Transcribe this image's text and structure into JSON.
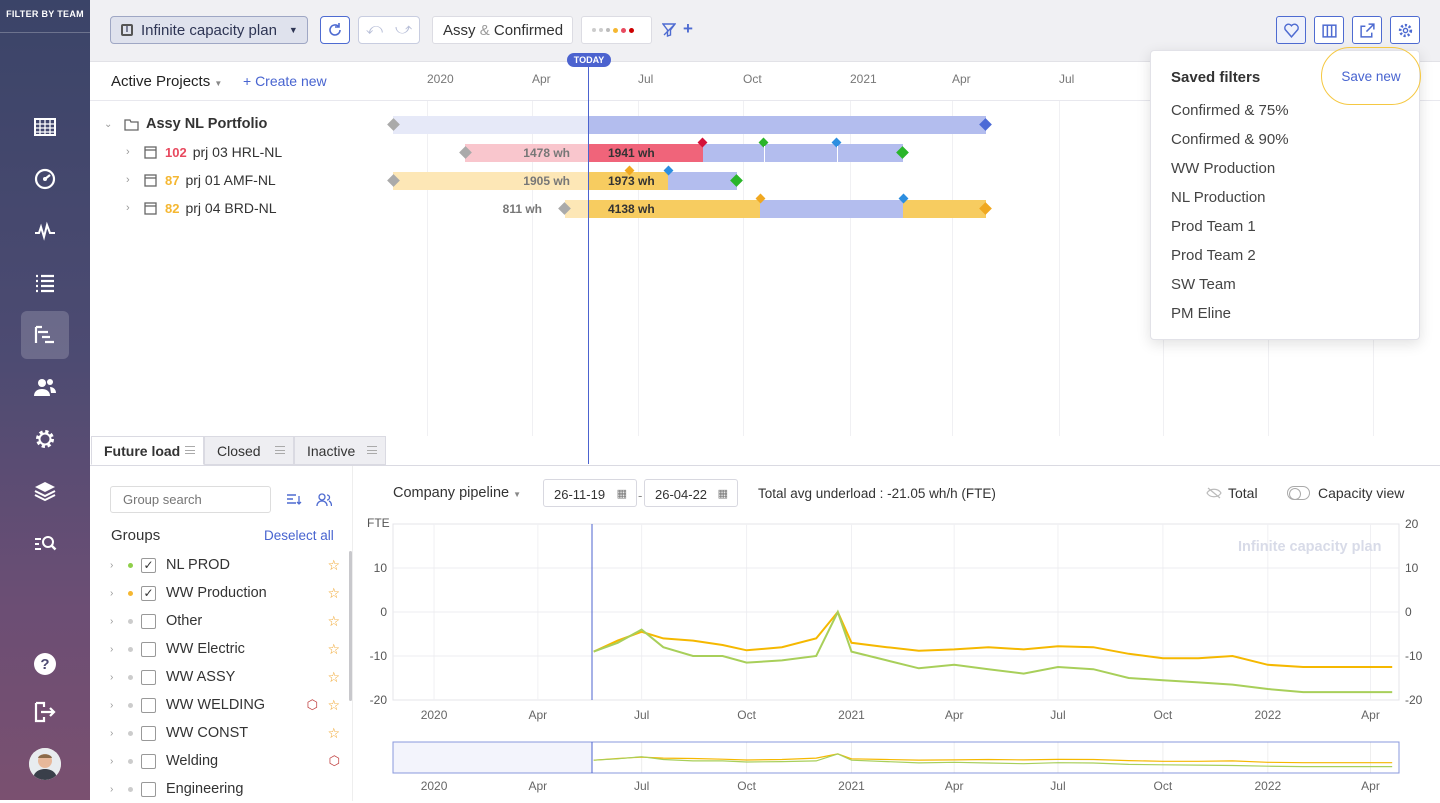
{
  "sidebar": {
    "title": "FILTER BY TEAM"
  },
  "toolbar": {
    "plan_name": "Infinite capacity plan",
    "filter_label_1": "Assy",
    "filter_amp": "&",
    "filter_label_2": "Confirmed",
    "plus": "+"
  },
  "timeline": {
    "active_projects": "Active Projects",
    "create_new": "+  Create new",
    "today": "TODAY",
    "months": [
      "2020",
      "Apr",
      "Jul",
      "Oct",
      "2021",
      "Apr",
      "Jul"
    ]
  },
  "projects": [
    {
      "name": "Assy NL Portfolio"
    },
    {
      "num": "102",
      "name": "prj 03 HRL-NL",
      "past": "1478 wh",
      "future": "1941 wh",
      "num_color": "#e84a5f"
    },
    {
      "num": "87",
      "name": "prj 01 AMF-NL",
      "past": "1905 wh",
      "future": "1973 wh",
      "num_color": "#f5b731"
    },
    {
      "num": "82",
      "name": "prj 04 BRD-NL",
      "past": "811 wh",
      "future": "4138 wh",
      "num_color": "#f5b731"
    }
  ],
  "saved_filters": {
    "title": "Saved filters",
    "save_new": "Save new",
    "items": [
      "Confirmed & 75%",
      "Confirmed & 90%",
      "WW Production",
      "NL Production",
      "Prod Team 1",
      "Prod Team 2",
      "SW Team",
      "PM Eline"
    ]
  },
  "tabs": [
    "Future load",
    "Closed",
    "Inactive"
  ],
  "groups_panel": {
    "search_placeholder": "Group search",
    "title": "Groups",
    "deselect": "Deselect all",
    "items": [
      {
        "name": "NL PROD",
        "checked": true,
        "dot": "#8fcf4a"
      },
      {
        "name": "WW Production",
        "checked": true,
        "dot": "#f5b731"
      },
      {
        "name": "Other",
        "checked": false
      },
      {
        "name": "WW Electric",
        "checked": false
      },
      {
        "name": "WW ASSY",
        "checked": false
      },
      {
        "name": "WW WELDING",
        "checked": false
      },
      {
        "name": "WW CONST",
        "checked": false
      },
      {
        "name": "Welding",
        "checked": false
      },
      {
        "name": "Engineering",
        "checked": false
      }
    ],
    "check_mark": "✓"
  },
  "load_chart": {
    "pipeline": "Company pipeline",
    "date_from": "26-11-19",
    "date_sep": "-",
    "date_to": "26-04-22",
    "total_avg": "Total avg underload : -21.05 wh/h (FTE)",
    "total_label": "Total",
    "capacity_label": "Capacity view",
    "watermark": "Infinite capacity plan",
    "ylabel": "FTE"
  },
  "chart_data": {
    "type": "line",
    "ylabel": "FTE",
    "ylim": [
      -20,
      20
    ],
    "yticks": [
      10,
      0,
      -10,
      -20
    ],
    "yticks_right": [
      20,
      10,
      0,
      -10,
      -20
    ],
    "xticks": [
      "2020",
      "Apr",
      "Jul",
      "Oct",
      "2021",
      "Apr",
      "Jul",
      "Oct",
      "2022",
      "Apr"
    ],
    "series": [
      {
        "color": "#f5b800",
        "x": [
          "2020-05-20",
          "2020-06-10",
          "2020-07-01",
          "2020-07-20",
          "2020-08-15",
          "2020-09-10",
          "2020-10-01",
          "2020-11-01",
          "2020-12-01",
          "2020-12-20",
          "2021-01-01",
          "2021-02-01",
          "2021-03-01",
          "2021-04-01",
          "2021-05-01",
          "2021-06-01",
          "2021-07-01",
          "2021-08-01",
          "2021-09-01",
          "2021-10-01",
          "2021-11-01",
          "2021-12-01",
          "2022-01-01",
          "2022-02-01",
          "2022-03-01",
          "2022-04-20"
        ],
        "y": [
          -9,
          -6.5,
          -4.5,
          -6,
          -6.5,
          -7.5,
          -8.7,
          -8,
          -6,
          0,
          -7,
          -8,
          -8.8,
          -8.5,
          -8,
          -8.5,
          -7.8,
          -8,
          -9.5,
          -10.5,
          -10.5,
          -10,
          -12,
          -12.5,
          -12.5,
          -12.5
        ]
      },
      {
        "color": "#a8cf5a",
        "x": [
          "2020-05-20",
          "2020-06-10",
          "2020-07-01",
          "2020-07-20",
          "2020-08-15",
          "2020-09-10",
          "2020-10-01",
          "2020-11-01",
          "2020-12-01",
          "2020-12-20",
          "2021-01-01",
          "2021-02-01",
          "2021-03-01",
          "2021-04-01",
          "2021-05-01",
          "2021-06-01",
          "2021-07-01",
          "2021-08-01",
          "2021-09-01",
          "2021-10-01",
          "2021-11-01",
          "2021-12-01",
          "2022-01-01",
          "2022-02-01",
          "2022-03-01",
          "2022-04-20"
        ],
        "y": [
          -9,
          -7,
          -4,
          -8,
          -10,
          -10,
          -11.5,
          -11,
          -10,
          0,
          -9,
          -11,
          -12.8,
          -12,
          -13,
          -14,
          -12.5,
          -13,
          -15,
          -15.5,
          -16,
          -16.5,
          -17.5,
          -18.2,
          -18.2,
          -18.2
        ]
      }
    ]
  }
}
